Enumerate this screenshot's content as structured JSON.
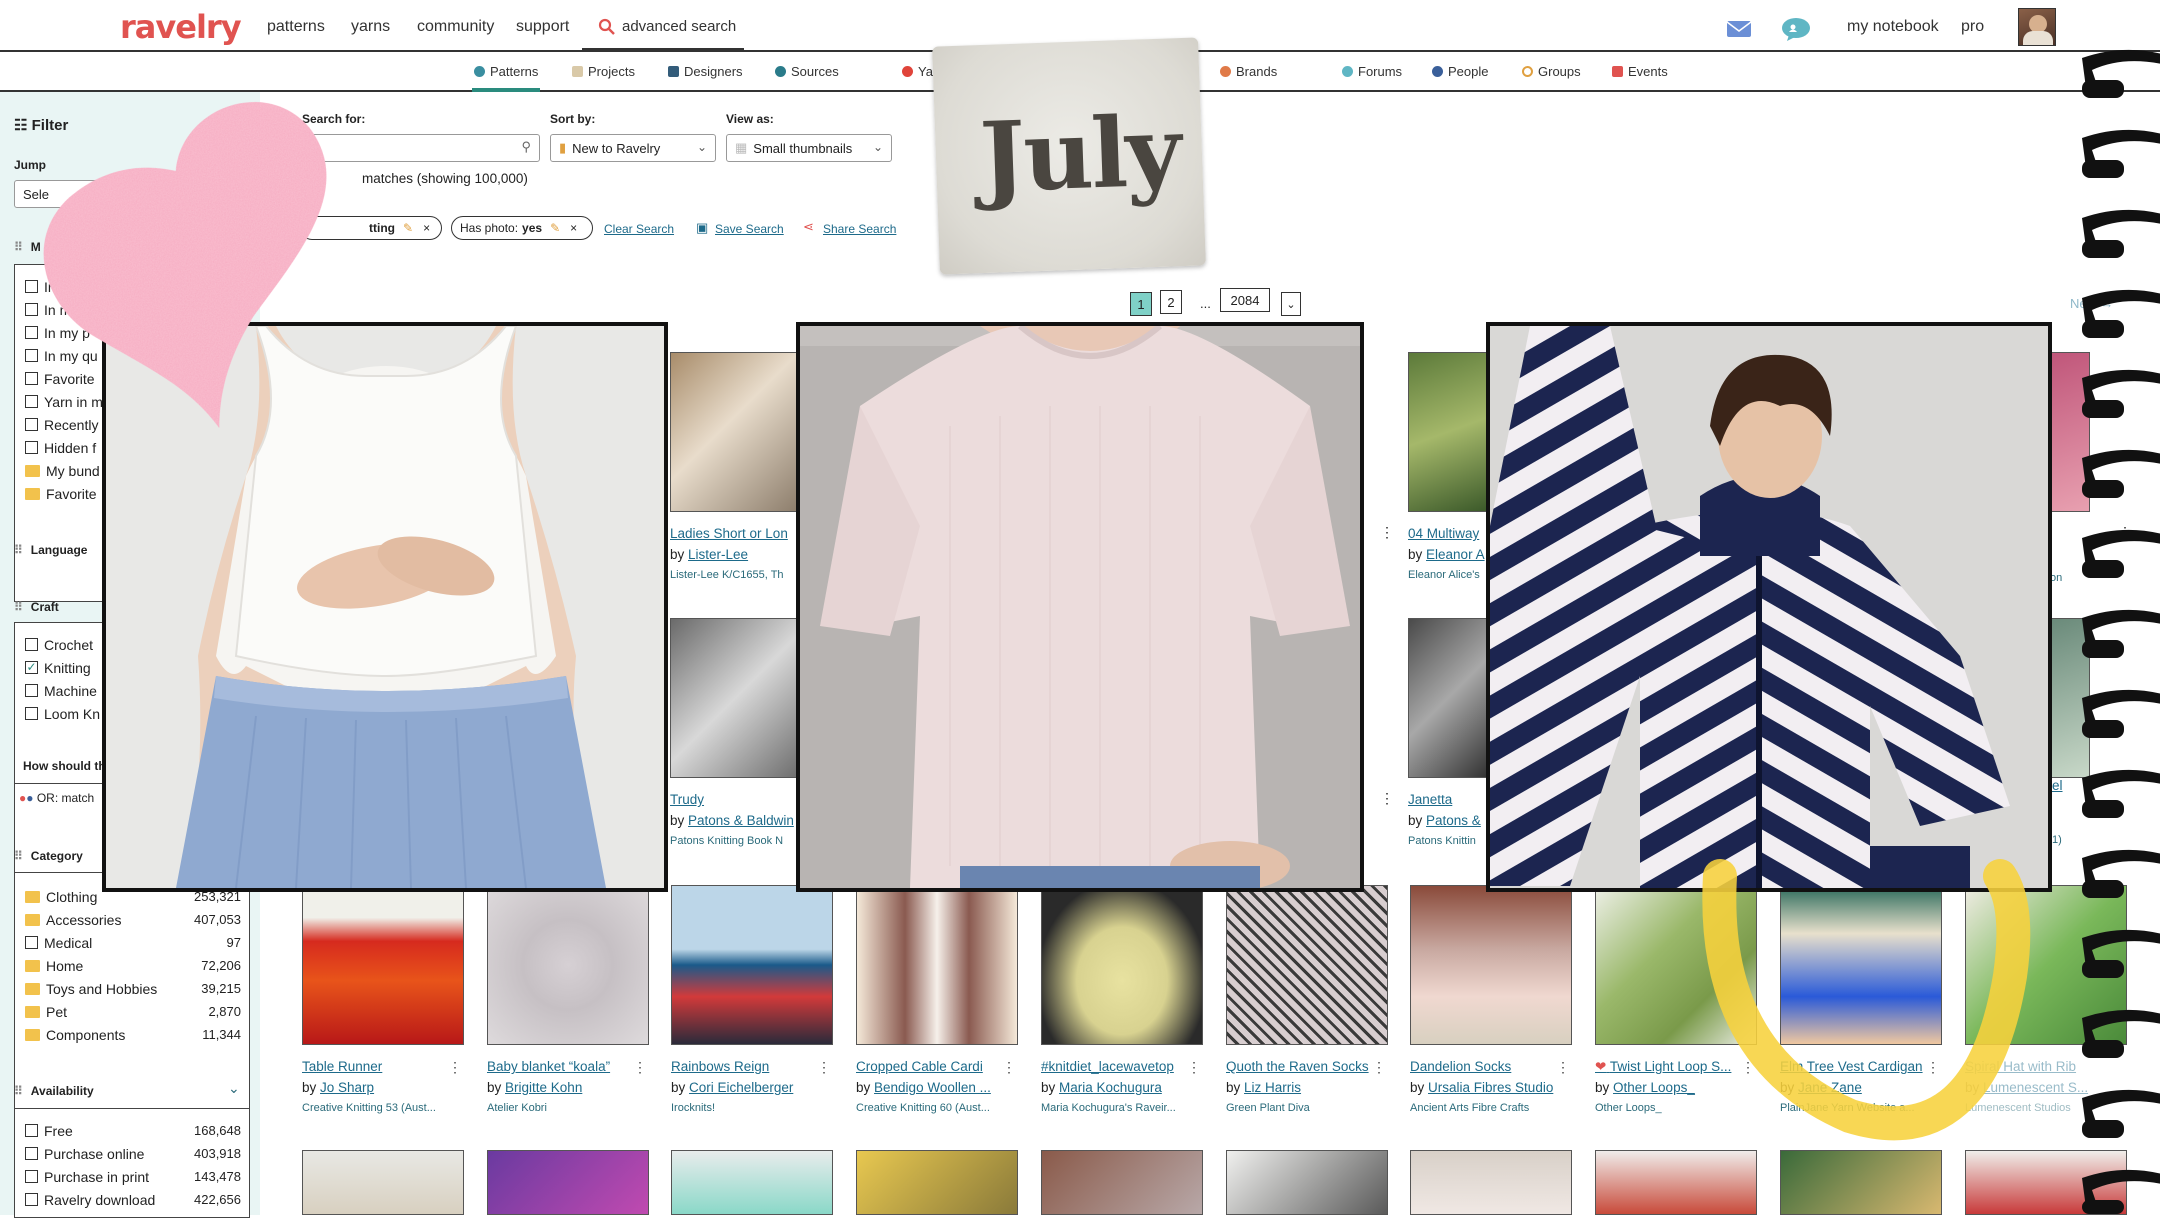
{
  "topnav": {
    "logo": "ravelry",
    "links": [
      "patterns",
      "yarns",
      "community",
      "support"
    ],
    "search_label": "advanced search",
    "right_links": [
      "my notebook",
      "pro"
    ]
  },
  "subnav": {
    "items": [
      "Patterns",
      "Projects",
      "Designers",
      "Sources",
      "Yar",
      "Brands",
      "Forums",
      "People",
      "Groups",
      "Events"
    ]
  },
  "sidebar": {
    "title": "Filter",
    "jump_label": "Jump",
    "jump_select": "Sele",
    "my_section_label": "M",
    "my_items": [
      "In",
      "In m",
      "In my p",
      "In my qu",
      "Favorite",
      "Yarn in m",
      "Recently",
      "Hidden f",
      "My bund",
      "Favorite"
    ],
    "language_label": "Language",
    "craft_label": "Craft",
    "craft_items": [
      {
        "label": "Crochet",
        "checked": false
      },
      {
        "label": "Knitting",
        "checked": true
      },
      {
        "label": "Machine",
        "checked": false
      },
      {
        "label": "Loom Kn",
        "checked": false
      }
    ],
    "how_label": "How should th",
    "match_value": "OR: match",
    "category_label": "Category",
    "categories": [
      {
        "label": "Clothing",
        "count": "253,321"
      },
      {
        "label": "Accessories",
        "count": "407,053"
      },
      {
        "label": "Medical",
        "count": "97"
      },
      {
        "label": "Home",
        "count": "72,206"
      },
      {
        "label": "Toys and Hobbies",
        "count": "39,215"
      },
      {
        "label": "Pet",
        "count": "2,870"
      },
      {
        "label": "Components",
        "count": "11,344"
      }
    ],
    "availability_label": "Availability",
    "availability": [
      {
        "label": "Free",
        "count": "168,648"
      },
      {
        "label": "Purchase online",
        "count": "403,918"
      },
      {
        "label": "Purchase in print",
        "count": "143,478"
      },
      {
        "label": "Ravelry download",
        "count": "422,656"
      }
    ]
  },
  "search": {
    "search_for_label": "Search for:",
    "sort_label": "Sort by:",
    "sort_value": "New to Ravelry",
    "view_label": "View as:",
    "view_value": "Small thumbnails",
    "matches_text": "matches (showing 100,000)",
    "chip1": "tting",
    "chip2_label": "Has photo:",
    "chip2_value": "yes",
    "clear": "Clear Search",
    "save": "Save Search",
    "share": "Share Search"
  },
  "pagination": {
    "pages": [
      "1",
      "2"
    ],
    "ellipsis": "...",
    "last": "2084",
    "next": "Next →"
  },
  "sticker": {
    "text": "July"
  },
  "cards_row1": [
    {
      "title": "Ladies Short or Lon",
      "by": "by",
      "author": "Lister-Lee",
      "source": "Lister-Lee K/C1655, Th"
    },
    {
      "title": "04 Multiway",
      "by": "by",
      "author": "Eleanor A",
      "source": "Eleanor Alice's"
    }
  ],
  "cards_row2": [
    {
      "title": "Trudy",
      "by": "by",
      "author": "Patons & Baldwin",
      "source": "Patons Knitting Book N"
    },
    {
      "title": "Janetta",
      "by": "by",
      "author": "Patons &",
      "source": "Patons Knittin"
    }
  ],
  "right_partial": {
    "row1_src": "on",
    "row2_title": "el",
    "row2_src": "1)"
  },
  "cards_row3": [
    {
      "title": "Table Runner",
      "by": "by",
      "author": "Jo Sharp",
      "source": "Creative Knitting 53 (Aust..."
    },
    {
      "title": "Baby blanket “koala”",
      "by": "by",
      "author": "Brigitte Kohn",
      "source": "Atelier Kobri"
    },
    {
      "title": "Rainbows Reign",
      "by": "by",
      "author": "Cori Eichelberger",
      "source": "Irocknits!"
    },
    {
      "title": "Cropped Cable Cardi",
      "by": "by",
      "author": "Bendigo Woollen ...",
      "source": "Creative Knitting 60 (Aust..."
    },
    {
      "title": "#knitdiet_lacewavetop",
      "by": "by",
      "author": "Maria Kochugura",
      "source": "Maria Kochugura's Raveir..."
    },
    {
      "title": "Quoth the Raven Socks",
      "by": "by",
      "author": "Liz Harris",
      "source": "Green Plant Diva"
    },
    {
      "title": "Dandelion Socks",
      "by": "by",
      "author": "Ursalia Fibres Studio",
      "source": "Ancient Arts Fibre Crafts"
    },
    {
      "title": "Twist Light Loop S...",
      "by": "by",
      "author": "Other Loops_",
      "source": "Other Loops_"
    },
    {
      "title": "Elm Tree Vest Cardigan",
      "by": "by",
      "author": "Jane Zane",
      "source": "PlainJane Yarn Website a..."
    },
    {
      "title": "Spiral Hat with Rib",
      "by": "by",
      "author": "Lumenescent S...",
      "source": "Lumenescent Studios"
    }
  ],
  "colors": {
    "brand": "#e05350",
    "link": "#1d6a8a",
    "sidebar_bg": "#e9f5f4",
    "accent_teal": "#2a8b7e",
    "heart": "#f6a9c0",
    "yellow_swoosh": "#f7d23c"
  }
}
